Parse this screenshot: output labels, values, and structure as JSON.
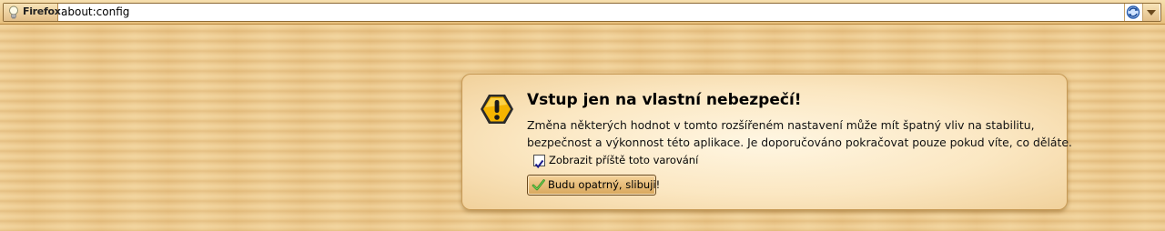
{
  "urlbar": {
    "identity_label": "Firefox",
    "url": "about:config",
    "icons": [
      "lightbulb-icon",
      "reload-icon",
      "dropdown-icon"
    ]
  },
  "warning": {
    "title": "Vstup jen na vlastní nebezpečí!",
    "text_line1": "Změna některých hodnot v tomto rozšířeném nastavení může mít špatný vliv na stabilitu,",
    "text_line2": "bezpečnost a výkonnost této aplikace. Je doporučováno pokračovat pouze pokud víte, co děláte.",
    "checkbox_label": "Zobrazit příště toto varování",
    "checkbox_checked": true,
    "confirm_button": "Budu opatrný, slibuji!",
    "icon": "warning-icon"
  },
  "colors": {
    "background": "#ecc98e",
    "warning_icon": "#f5b400",
    "check": "#2f8f1f"
  }
}
